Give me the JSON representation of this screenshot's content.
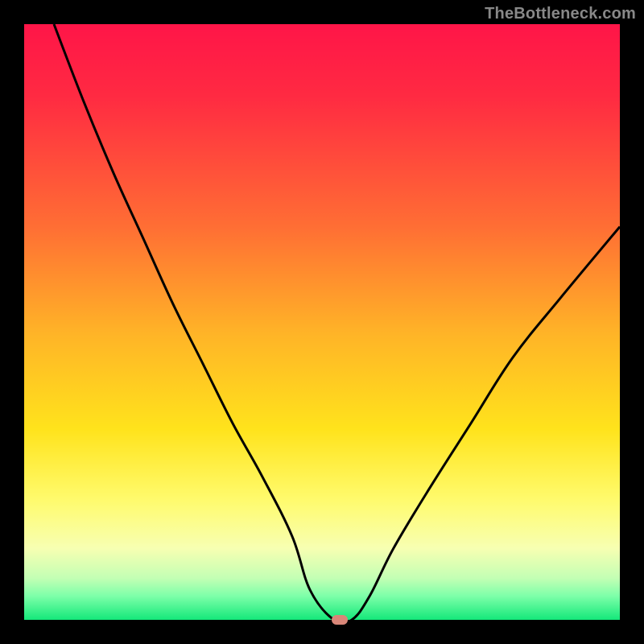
{
  "watermark": "TheBottleneck.com",
  "colors": {
    "curve_stroke": "#000000",
    "marker_fill": "#d98678",
    "frame": "#000000"
  },
  "chart_data": {
    "type": "line",
    "title": "",
    "xlabel": "",
    "ylabel": "",
    "xlim": [
      0,
      100
    ],
    "ylim": [
      0,
      100
    ],
    "grid": false,
    "legend": false,
    "annotations": [],
    "series": [
      {
        "name": "bottleneck-curve",
        "x": [
          5,
          10,
          15,
          20,
          25,
          30,
          35,
          40,
          45,
          48,
          52,
          55,
          58,
          62,
          68,
          75,
          82,
          90,
          100
        ],
        "values": [
          100,
          87,
          75,
          64,
          53,
          43,
          33,
          24,
          14,
          5,
          0,
          0,
          4,
          12,
          22,
          33,
          44,
          54,
          66
        ]
      }
    ],
    "marker": {
      "x": 53,
      "y": 0
    }
  }
}
